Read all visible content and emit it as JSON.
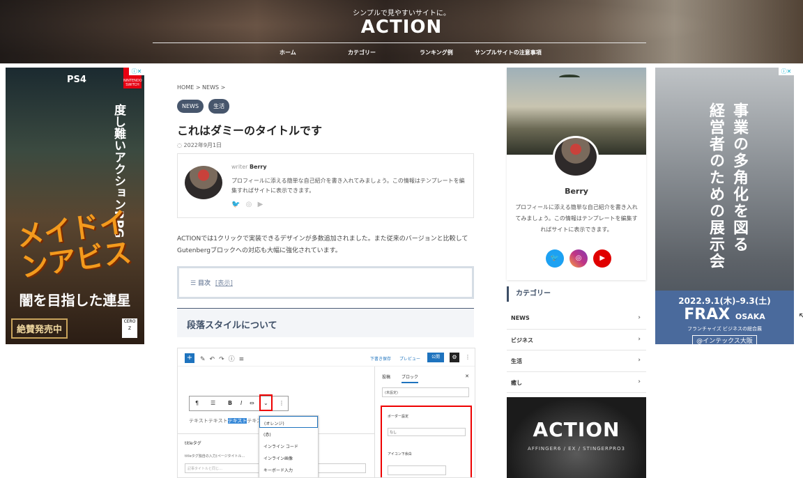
{
  "header": {
    "tagline": "シンプルで見やすいサイトに。",
    "logo": "ACTION",
    "nav": [
      "ホーム",
      "カテゴリー",
      "ランキング例",
      "サンプルサイトの注意事項"
    ]
  },
  "ad_left": {
    "ps4": "PS4",
    "switch": "NINTENDO SWITCH",
    "sub1": "度し難いアクションRPG",
    "title": "メイドインアビス",
    "sub2": "闇を目指した連星",
    "sale": "絶賛発売中",
    "cero": "CERO Z",
    "adchoice": "ⓘ✕"
  },
  "ad_right": {
    "vcol1": "事業の多角化を図る",
    "vcol2": "経営者のための展示会",
    "date": "2022.9.1(木)–9.3(土)",
    "frax": "FRAX",
    "frax_city": "OSAKA",
    "frax_sub": "フランチャイズ ビジネスの総合展",
    "venue": "@インテックス大阪",
    "adchoice": "ⓘ✕"
  },
  "article": {
    "breadcrumb": "HOME > NEWS >",
    "tags": [
      "NEWS",
      "生活"
    ],
    "title": "これはダミーのタイトルです",
    "date": "◌ 2022年9月1日",
    "author": {
      "writer_label": "writer",
      "name": "Berry",
      "desc": "プロフィールに添える簡単な自己紹介を書き入れてみましょう。この情報はテンプレートを編集すればサイトに表示できます。",
      "socials": [
        "twitter-icon",
        "instagram-icon",
        "youtube-icon"
      ]
    },
    "intro": "ACTIONでは1クリックで実装できるデザインが多数追加されました。また従来のバージョンと比較してGutenbergブロックへの対応も大幅に強化されています。",
    "toc_label": "目次",
    "toc_toggle": "[表示]",
    "h2": "段落スタイルについて"
  },
  "editor": {
    "draft": "下書き保存",
    "preview": "プレビュー",
    "publish": "公開",
    "side_tabs": [
      "投稿",
      "ブロック"
    ],
    "side_select": "(未設定)",
    "border_label": "ボーダー設定",
    "border_value": "なし",
    "align_label": "アイコン下余白",
    "dropdown": [
      "(オレンジ)",
      "(赤)",
      "インライン コード",
      "インライン画像",
      "キーボード入力"
    ],
    "text_before": "テキストテキスト",
    "text_hl": "テキスト",
    "text_after": "テキストテキ",
    "lower_title": "titleタグ",
    "lower_hint": "titleタグ独自の入力(ページタイトル…",
    "lower_input": "記事タイトルと同じ…"
  },
  "sidebar": {
    "name": "Berry",
    "desc": "プロフィールに添える簡単な自己紹介を書き入れてみましょう。この情報はテンプレートを編集すればサイトに表示できます。",
    "category_title": "カテゴリー",
    "categories": [
      "NEWS",
      "ビジネス",
      "生活",
      "癒し"
    ],
    "ad_title": "ACTION",
    "ad_sub": "AFFINGER6 / EX / STINGERPRO3"
  },
  "colors": {
    "accent": "#3d4e66",
    "tag_bg": "#47566c",
    "twitter": "#1da1f2",
    "instagram": "#c13584",
    "youtube": "#e00000"
  }
}
